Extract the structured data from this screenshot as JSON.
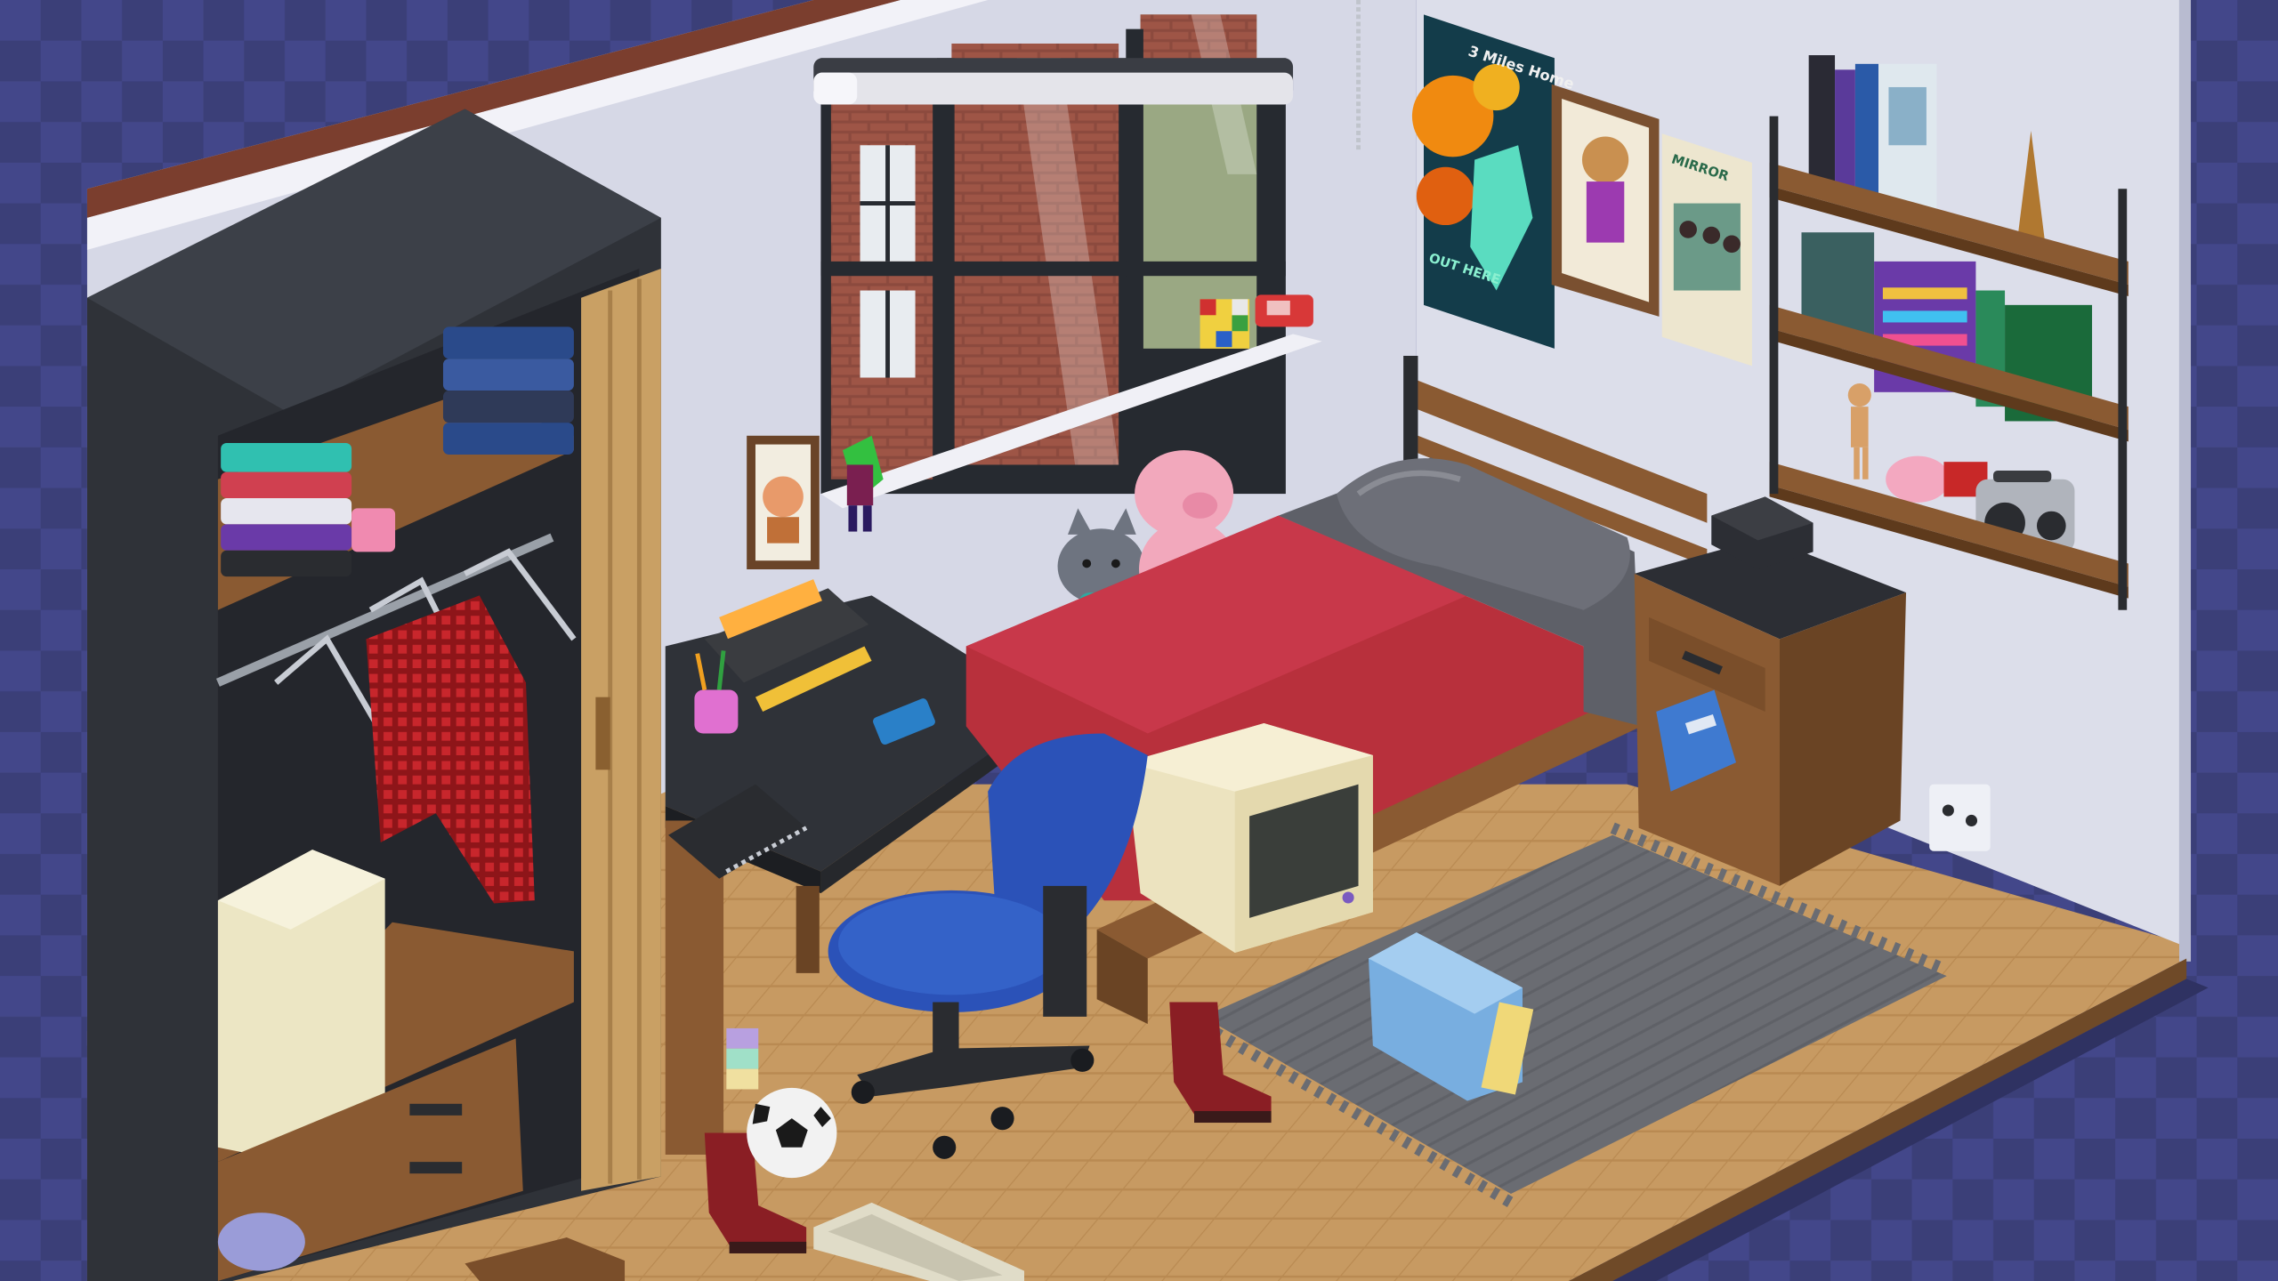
{
  "game": {
    "scene": "bedroom",
    "palette": {
      "background": "#3b3f78",
      "background_checker": "#4a4e8c",
      "wall": "#d6d8e6",
      "wall_shadow": "#bfc2d6",
      "floor": "#c79a62",
      "floor_dark": "#a97c48",
      "wardrobe": "#2f3238",
      "bed_sheet": "#b8303c",
      "pillow": "#6d6f78",
      "chair_seat": "#2b52b8",
      "rug": "#6a6c72",
      "monitor": "#ece3bf",
      "wood": "#8a5a32"
    },
    "wall_items": {
      "poster_big": {
        "title": "3 Miles Home",
        "tagline": "OUT HERE"
      },
      "poster_small": {
        "title": "MIRROR"
      }
    },
    "objects": [
      {
        "name": "wardrobe",
        "icon": "wardrobe-icon"
      },
      {
        "name": "window",
        "icon": "window-icon"
      },
      {
        "name": "bed",
        "icon": "bed-icon"
      },
      {
        "name": "desk",
        "icon": "desk-icon"
      },
      {
        "name": "office-chair",
        "icon": "chair-icon"
      },
      {
        "name": "crt-monitor",
        "icon": "monitor-icon"
      },
      {
        "name": "nightstand",
        "icon": "nightstand-icon"
      },
      {
        "name": "alarm-clock",
        "icon": "clock-icon"
      },
      {
        "name": "wall-shelves",
        "icon": "shelf-icon"
      },
      {
        "name": "boombox",
        "icon": "boombox-icon"
      },
      {
        "name": "rug",
        "icon": "rug-icon"
      },
      {
        "name": "messenger-bag",
        "icon": "bag-icon"
      },
      {
        "name": "soccer-ball",
        "icon": "ball-icon"
      },
      {
        "name": "boots",
        "icon": "boot-icon"
      },
      {
        "name": "keyboard",
        "icon": "keyboard-icon"
      },
      {
        "name": "plush-pig",
        "icon": "pig-icon"
      },
      {
        "name": "plush-cat",
        "icon": "cat-icon"
      },
      {
        "name": "rubiks-cube",
        "icon": "cube-icon"
      },
      {
        "name": "mini-fridge",
        "icon": "fridge-icon"
      }
    ]
  }
}
